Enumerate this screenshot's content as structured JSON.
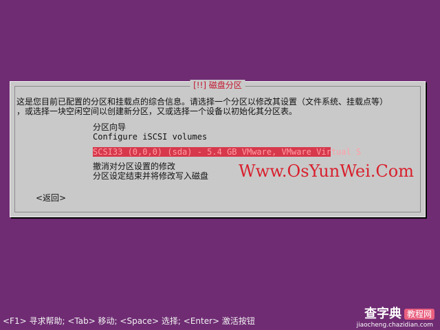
{
  "dialog": {
    "title": "[!!] 磁盘分区",
    "intro": "这是您目前已配置的分区和挂载点的综合信息。请选择一个分区以修改其设置（文件系统、挂载点等）\n，或选择一块空闲空间以创建新分区，又或选择一个设备以初始化其分区表。",
    "menu": {
      "guided": "分区向导",
      "iscsi": "Configure iSCSI volumes",
      "disk": "SCSI33 (0,0,0) (sda) - 5.4 GB VMware, VMware Virtual S",
      "undo": "撤消对分区设置的修改",
      "finish": "分区设定结束并将修改写入磁盘"
    },
    "back": "<返回>"
  },
  "watermark": "Www.OsYunWei.Com",
  "help": "<F1> 寻求帮助; <Tab> 移动; <Space> 选择; <Enter> 激活按钮",
  "site": {
    "main": "查字典",
    "sub": "教程网",
    "url": "jiaocheng.chazidian.com"
  },
  "colors": {
    "background": "#6f2c73",
    "dialog": "#c9c9c9",
    "title": "#c3162f",
    "selection": "#d7384b",
    "watermark": "#d8202d"
  }
}
